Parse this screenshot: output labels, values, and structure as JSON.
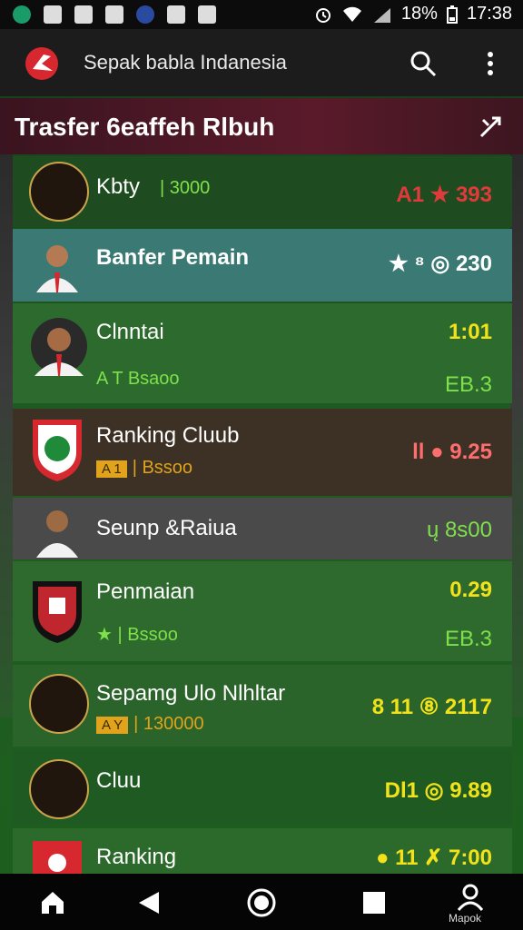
{
  "status": {
    "battery": "18%",
    "time": "17:38"
  },
  "app": {
    "title": "Sepak babla Indanesia"
  },
  "section": {
    "title": "Trasfer 6eaffeh Rlbuh"
  },
  "rows": [
    {
      "name": "Kbty",
      "sub": "| 3000",
      "right": "A1 ★ 393"
    },
    {
      "name": "Banfer Pemain",
      "right": "★ ⁸ ◎ 230"
    },
    {
      "name": "Clnntai",
      "sub": "A T  Bsaoo",
      "right_top": "1:01",
      "right_bottom": "EB.3"
    },
    {
      "name": "Ranking Cluub",
      "pill": "A 1",
      "sub": "| Bssoo",
      "right": "ll  ● 9.25"
    },
    {
      "name": "Seunp &Raiua",
      "right": "ų  8s00"
    },
    {
      "name": "Penmaian",
      "sub": "★ | Bssoo",
      "right_top": "0.29",
      "right_bottom": "EB.3"
    },
    {
      "name": "Sepamg Ulo Nlhltar",
      "pill": "A Y",
      "sub": "| 130000",
      "right": "8 11 ⑧  2117"
    },
    {
      "name": "Cluu",
      "right": "Dl1 ◎ 9.89"
    },
    {
      "name": "Ranking",
      "right": "● 11 ✗  7:00"
    }
  ],
  "nav": {
    "profile_label": "Mapok"
  },
  "colors": {
    "accent_red": "#d8282f",
    "green_text": "#7ee04a",
    "yellow_text": "#f2e21a"
  },
  "icons": [
    "search-icon",
    "more-icon",
    "share-icon",
    "home-icon",
    "back-icon",
    "home-circle-icon",
    "recents-icon",
    "profile-icon"
  ]
}
